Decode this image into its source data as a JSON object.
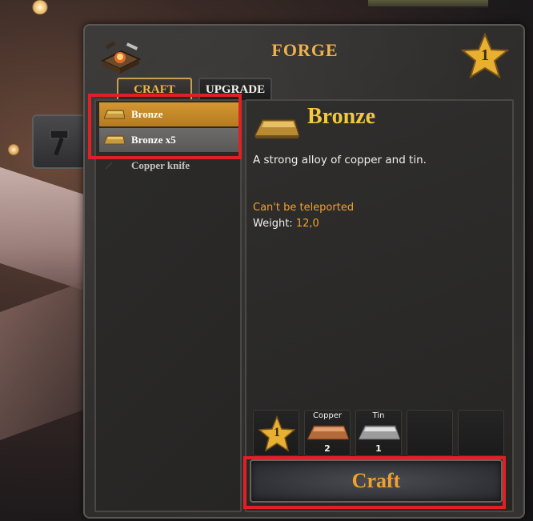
{
  "window": {
    "title": "FORGE",
    "level": "1"
  },
  "tabs": [
    {
      "label": "CRAFT",
      "active": true
    },
    {
      "label": "UPGRADE",
      "active": false
    }
  ],
  "recipes": [
    {
      "label": "Bronze",
      "selected": true
    },
    {
      "label": "Bronze x5",
      "selected": false
    },
    {
      "label": "Copper knife",
      "selected": false
    }
  ],
  "details": {
    "name": "Bronze",
    "description": "A strong alloy of copper and tin.",
    "teleport_note": "Can't be teleported",
    "weight_label": "Weight:",
    "weight_value": "12,0"
  },
  "requirements": {
    "station_level": "1",
    "items": [
      {
        "name": "Copper",
        "count": "2"
      },
      {
        "name": "Tin",
        "count": "1"
      }
    ]
  },
  "craft_button": {
    "label": "Craft"
  },
  "colors": {
    "accent_orange": "#f0a12e",
    "title_gold": "#f4c93c",
    "highlight_red": "#e01f26",
    "selected_row": "#d49631"
  }
}
